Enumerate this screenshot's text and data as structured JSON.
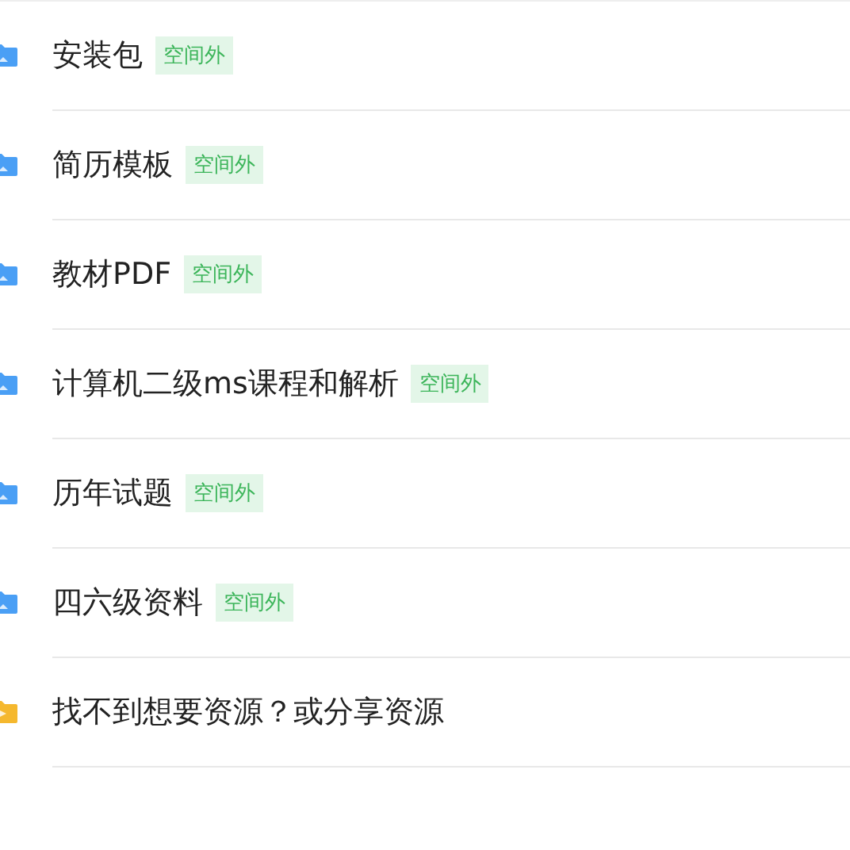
{
  "items": [
    {
      "kind": "folder",
      "label": "安装包",
      "tag": "空间外"
    },
    {
      "kind": "folder",
      "label": "简历模板",
      "tag": "空间外"
    },
    {
      "kind": "folder",
      "label": "教材PDF",
      "tag": "空间外"
    },
    {
      "kind": "folder",
      "label": "计算机二级ms课程和解析",
      "tag": "空间外"
    },
    {
      "kind": "folder",
      "label": "历年试题",
      "tag": "空间外"
    },
    {
      "kind": "folder",
      "label": "四六级资料",
      "tag": "空间外"
    },
    {
      "kind": "share",
      "label": "找不到想要资源？或分享资源"
    }
  ]
}
